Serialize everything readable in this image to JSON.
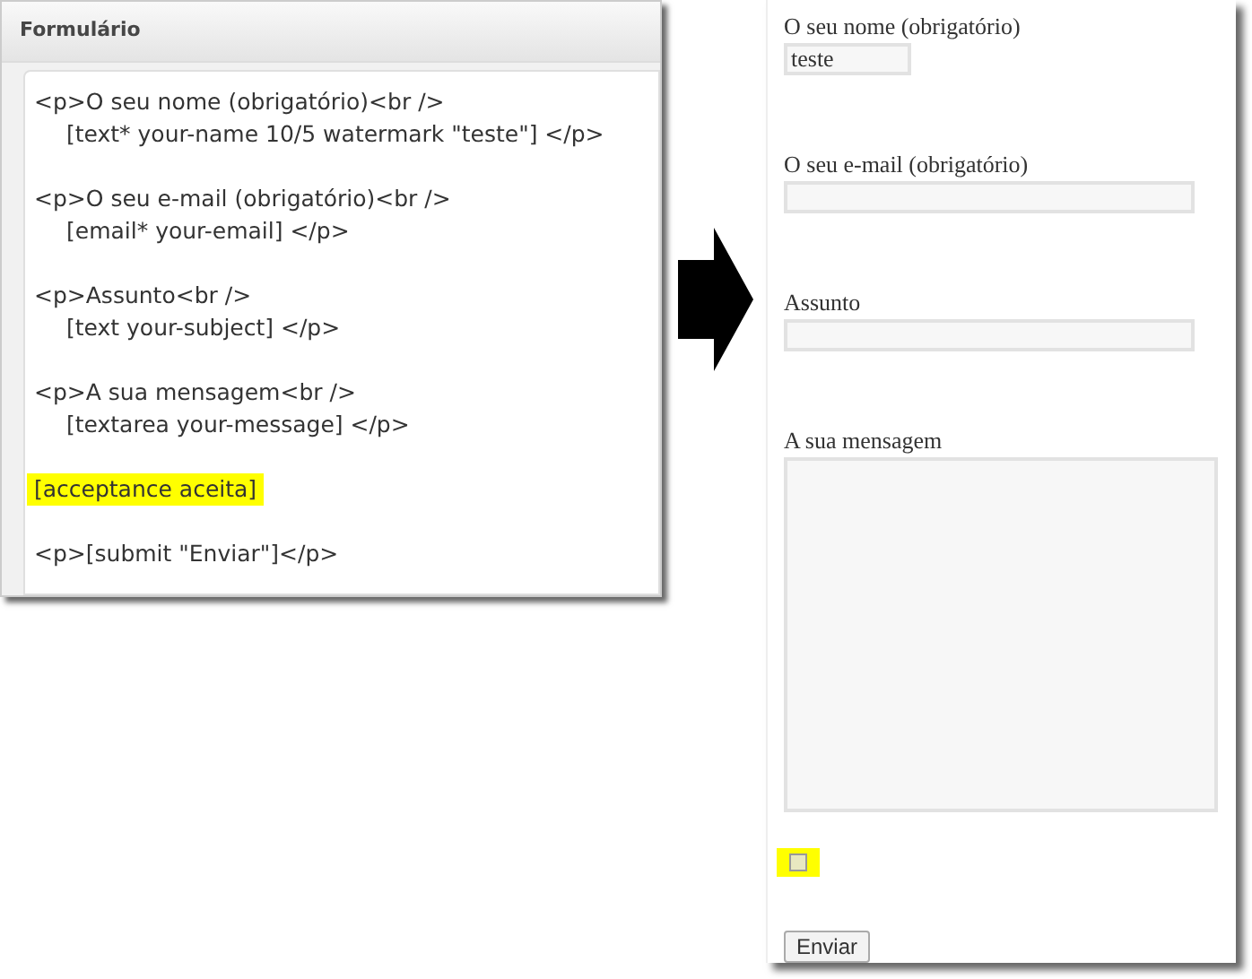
{
  "editor": {
    "title": "Formulário",
    "blocks": [
      {
        "lines": [
          "<p>O seu nome (obrigatório)<br />",
          "[text* your-name 10/5 watermark \"teste\"] </p>"
        ],
        "highlighted": false
      },
      {
        "lines": [
          "<p>O seu e-mail (obrigatório)<br />",
          "[email* your-email] </p>"
        ],
        "highlighted": false
      },
      {
        "lines": [
          "<p>Assunto<br />",
          "[text your-subject] </p>"
        ],
        "highlighted": false
      },
      {
        "lines": [
          "<p>A sua mensagem<br />",
          "[textarea your-message] </p>"
        ],
        "highlighted": false
      },
      {
        "lines": [
          "[acceptance aceita]"
        ],
        "highlighted": true
      },
      {
        "lines": [
          "<p>[submit \"Enviar\"]</p>"
        ],
        "highlighted": false
      }
    ]
  },
  "preview": {
    "fields": [
      {
        "kind": "short_text",
        "label": "O seu nome (obrigatório)",
        "value": "teste"
      },
      {
        "kind": "text",
        "label": "O seu e-mail (obrigatório)"
      },
      {
        "kind": "text",
        "label": "Assunto"
      },
      {
        "kind": "textarea",
        "label": "A sua mensagem"
      },
      {
        "kind": "checkbox",
        "checked": false,
        "highlighted": true
      },
      {
        "kind": "submit",
        "label": "Enviar"
      }
    ]
  }
}
